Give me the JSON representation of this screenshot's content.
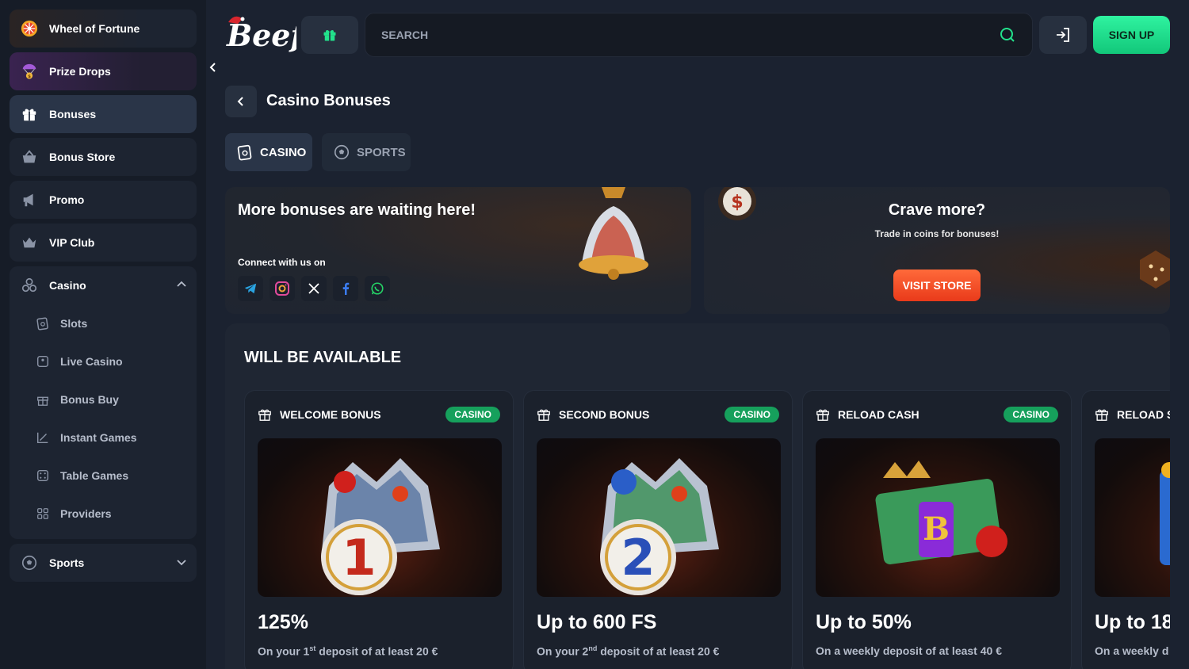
{
  "sidebar": {
    "items": [
      {
        "label": "Wheel of Fortune",
        "icon": "wheel-icon"
      },
      {
        "label": "Prize Drops",
        "icon": "prize-drop-icon"
      },
      {
        "label": "Bonuses",
        "icon": "gift-icon"
      },
      {
        "label": "Bonus Store",
        "icon": "basket-icon"
      },
      {
        "label": "Promo",
        "icon": "megaphone-icon"
      },
      {
        "label": "VIP Club",
        "icon": "crown-icon"
      }
    ],
    "casino": {
      "label": "Casino",
      "sub": [
        "Slots",
        "Live Casino",
        "Bonus Buy",
        "Instant Games",
        "Table Games",
        "Providers"
      ]
    },
    "sports": {
      "label": "Sports"
    }
  },
  "header": {
    "logo": "Beef",
    "search_placeholder": "SEARCH",
    "signup": "SIGN UP"
  },
  "page": {
    "title": "Casino Bonuses",
    "tabs": [
      "CASINO",
      "SPORTS"
    ]
  },
  "banners": {
    "left": {
      "title": "More bonuses are waiting here!",
      "connect": "Connect with us on",
      "socials": [
        "telegram-icon",
        "instagram-icon",
        "x-icon",
        "facebook-icon",
        "whatsapp-icon"
      ]
    },
    "right": {
      "title": "Crave more?",
      "subtitle": "Trade in coins for bonuses!",
      "button": "VISIT STORE"
    }
  },
  "available": {
    "title": "WILL BE AVAILABLE",
    "cards": [
      {
        "name": "WELCOME BONUS",
        "badge": "CASINO",
        "amount": "125%",
        "desc_pre": "On your 1",
        "desc_sup": "st",
        "desc_post": " deposit of at least 20 €",
        "digit": "1"
      },
      {
        "name": "SECOND BONUS",
        "badge": "CASINO",
        "amount": "Up to 600 FS",
        "desc_pre": "On your 2",
        "desc_sup": "nd",
        "desc_post": " deposit of at least 20 €",
        "digit": "2"
      },
      {
        "name": "RELOAD CASH",
        "badge": "CASINO",
        "amount": "Up to 50%",
        "desc_pre": "On a weekly deposit of at least 40 €",
        "desc_sup": "",
        "desc_post": "",
        "digit": "B"
      },
      {
        "name": "RELOAD S",
        "badge": "",
        "amount": "Up to 18(",
        "desc_pre": "On a weekly d",
        "desc_sup": "",
        "desc_post": "",
        "digit": ""
      }
    ]
  },
  "colors": {
    "background": "#1b2230",
    "sidebar": "#161c27",
    "accent_green": "#12c77a",
    "accent_orange": "#e93a1a",
    "badge_green": "#16a05c"
  }
}
